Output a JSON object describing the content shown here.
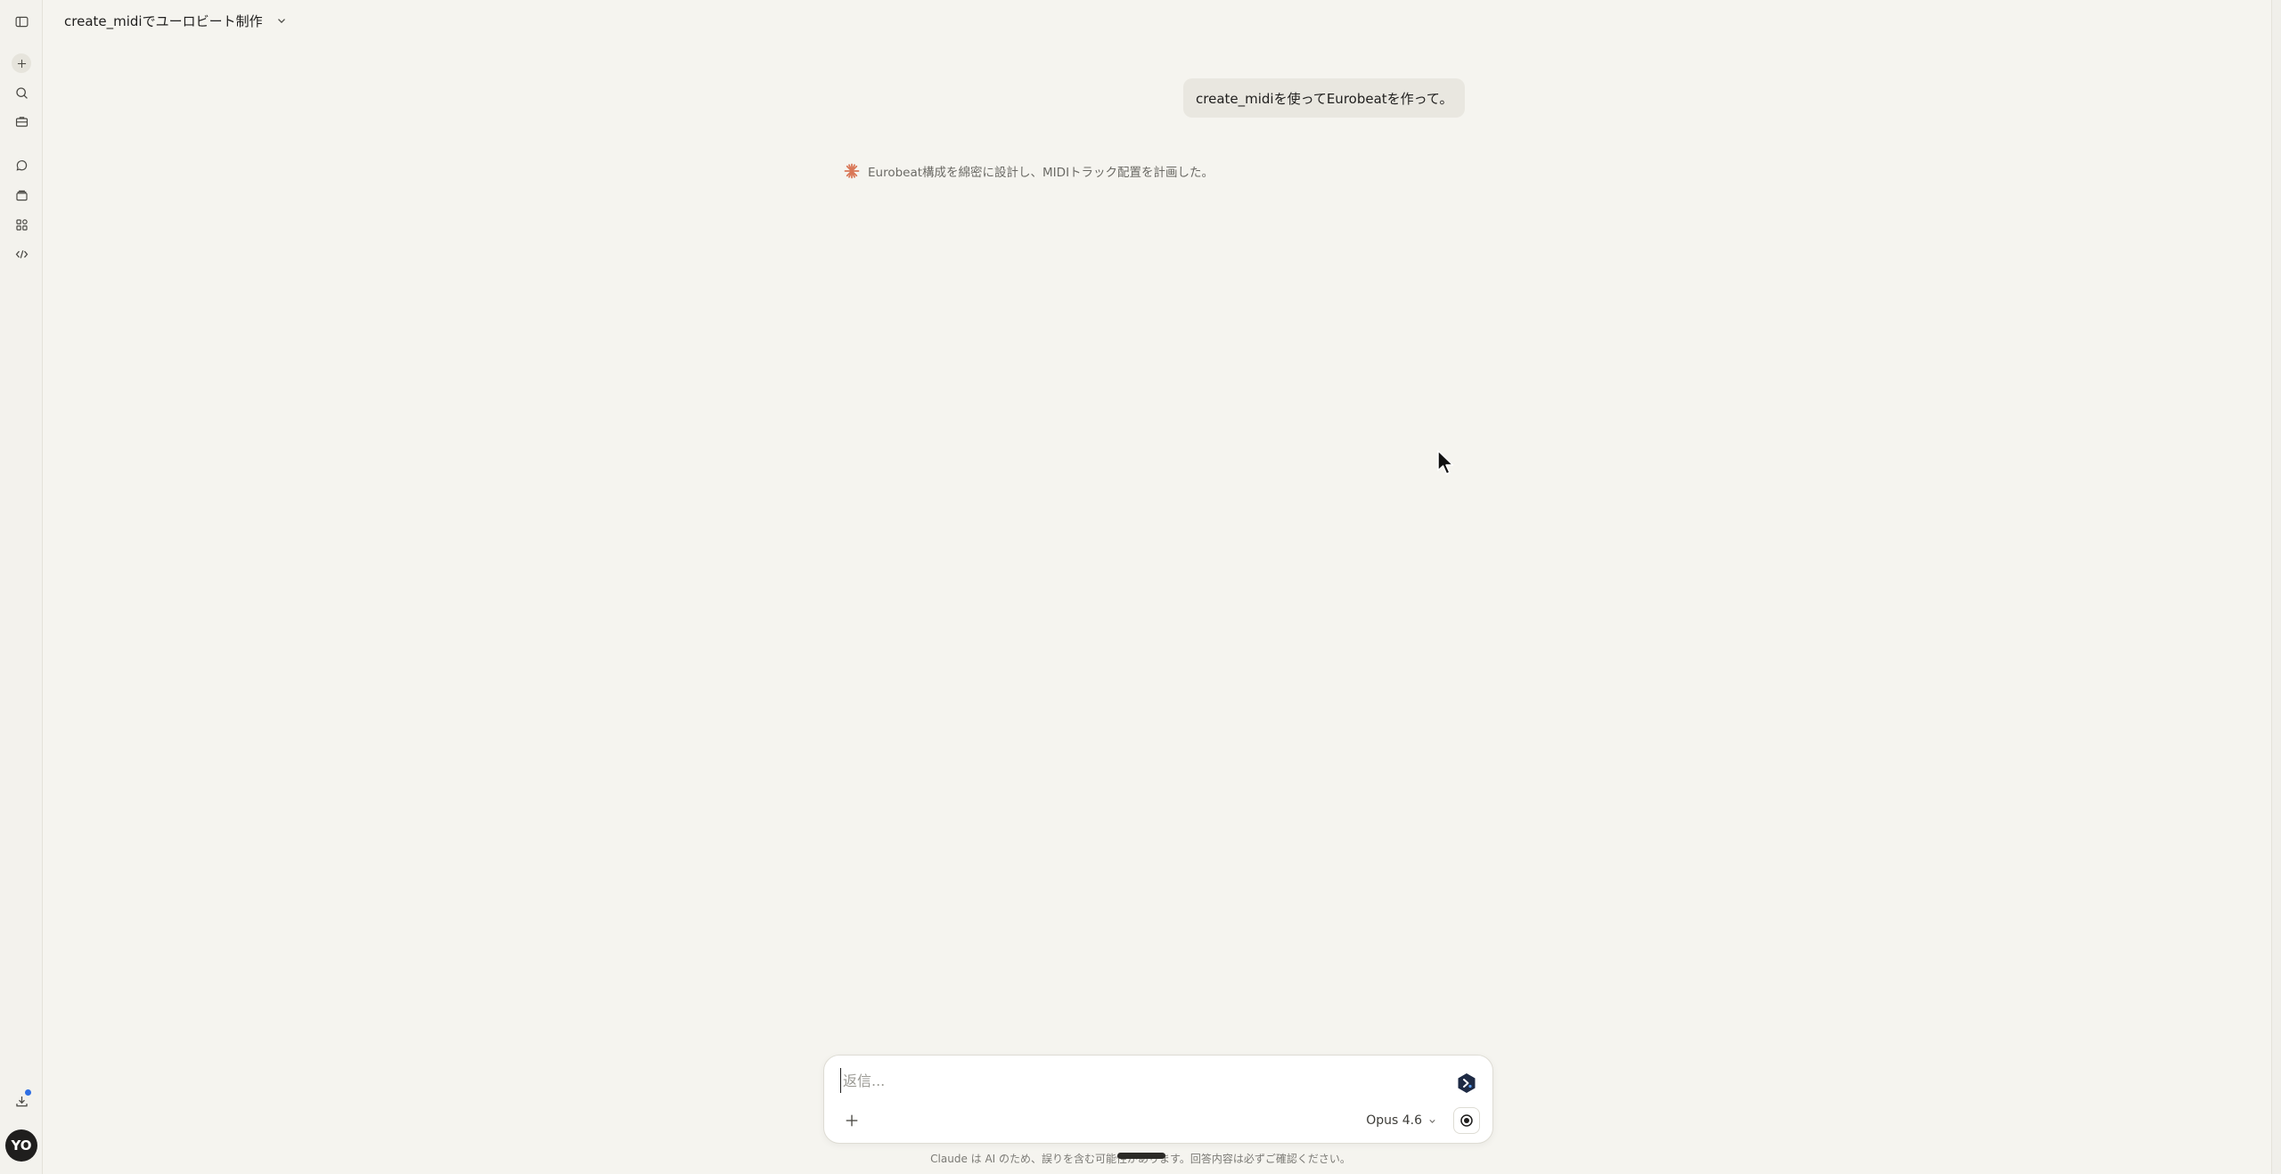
{
  "header": {
    "title": "create_midiでユーロビート制作"
  },
  "conversation": {
    "user_message": "create_midiを使ってEurobeatを作って。",
    "thinking_status": "Eurobeat構成を綿密に設計し、MIDIトラック配置を計画した。"
  },
  "composer": {
    "placeholder": "返信...",
    "value": "",
    "model": "Opus 4.6"
  },
  "footer": {
    "disclaimer": "Claude は AI のため、誤りを含む可能性があります。回答内容は必ずご確認ください。"
  },
  "user": {
    "initials": "YO"
  },
  "colors": {
    "background": "#f5f4ef",
    "accent": "#d97757",
    "notification": "#2f6fe4"
  },
  "icons": {
    "rail": [
      "sidebar-toggle-icon",
      "new-chat-icon",
      "search-icon",
      "briefcase-icon",
      "chats-icon",
      "projects-icon",
      "artifacts-icon",
      "code-icon",
      "download-icon"
    ],
    "composer": [
      "extension-icon",
      "plus-icon",
      "chevron-down-icon",
      "voice-icon"
    ]
  }
}
